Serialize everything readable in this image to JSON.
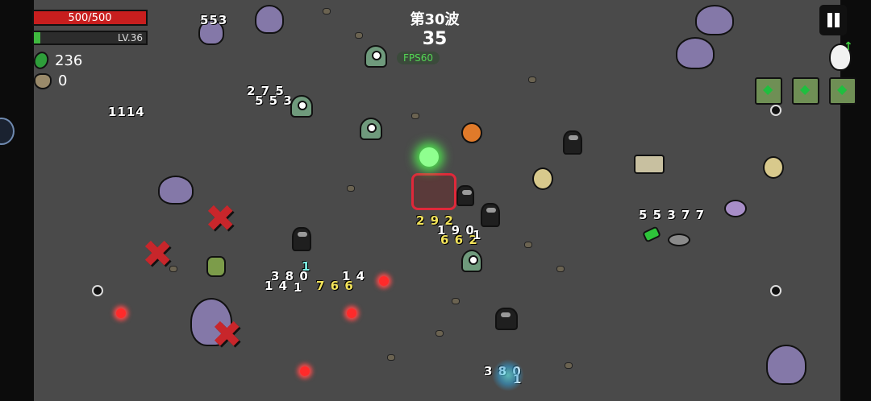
{
  "hud": {
    "hp_text": "500/500",
    "hp_fraction": 1.0,
    "level_text": "LV.36",
    "xp_fraction": 0.06,
    "gems": "236",
    "bags": "0",
    "wave_text": "第30波",
    "timer": "35",
    "fps_text": "FPS60"
  },
  "icons": {
    "pause": "pause-icon",
    "egg": "egg-icon",
    "gem": "gem-icon",
    "bag": "bag-icon"
  },
  "damage_numbers": [
    "553",
    "2 7 5",
    "5 5 3",
    "1114",
    "2 9 2",
    "1 9 0",
    "6 6 2",
    "1",
    "3 8 0",
    "1",
    "1 4",
    "1",
    "7 6 6",
    "1 4",
    "5 5 3 7 7",
    "3 8 0",
    "1"
  ],
  "colors": {
    "hp": "#c81e1e",
    "xp": "#3fb93f",
    "fps": "#54d654",
    "background": "#4a4a4a",
    "bullet": "#ff2a2a"
  }
}
